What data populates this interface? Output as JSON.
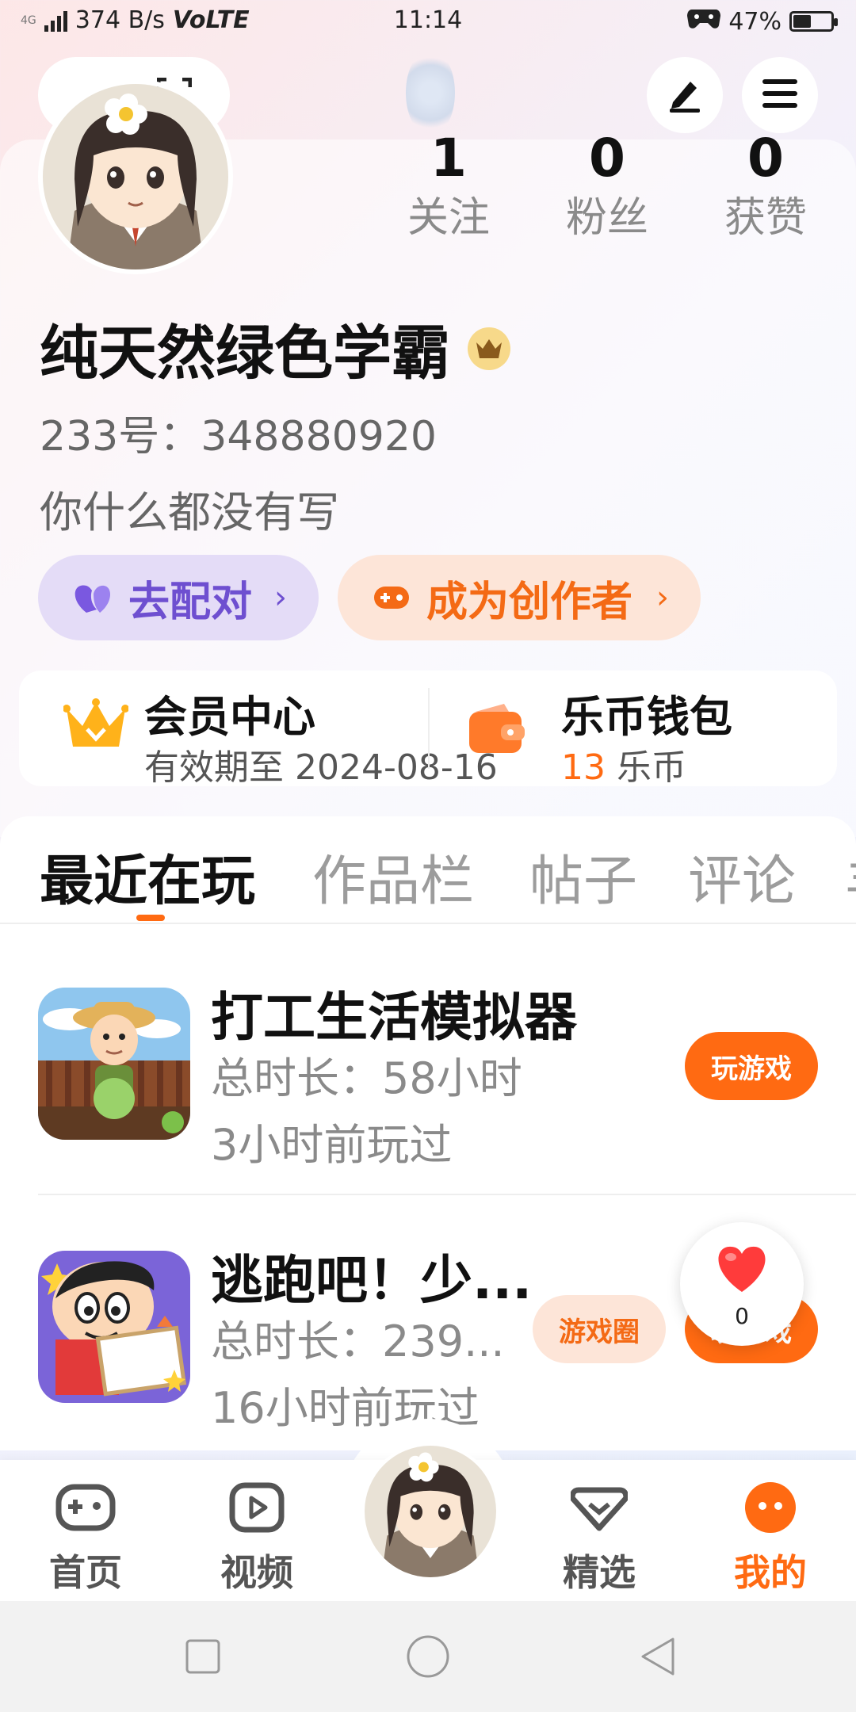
{
  "status_bar": {
    "network_type": "4G",
    "speed": "374 B/s",
    "volte": "VoLTE",
    "time": "11:14",
    "battery_percent": "47%",
    "battery_level": 0.47
  },
  "header": {
    "icons": [
      "scan-icon",
      "pencil-icon",
      "menu-icon"
    ]
  },
  "profile": {
    "stats": [
      {
        "value": "1",
        "label": "关注"
      },
      {
        "value": "0",
        "label": "粉丝"
      },
      {
        "value": "0",
        "label": "获赞"
      }
    ],
    "username": "纯天然绿色学霸",
    "uid": "233号：348880920",
    "bio": "你什么都没有写",
    "buttons": {
      "pair": "去配对",
      "creator": "成为创作者",
      "chevron": "›"
    }
  },
  "vip": {
    "member_title": "会员中心",
    "member_sub": "有效期至 2024-08-16",
    "wallet_title": "乐币钱包",
    "wallet_amount": "13",
    "wallet_unit": "乐币"
  },
  "tabs": [
    "最近在玩",
    "作品栏",
    "帖子",
    "评论",
    "羊"
  ],
  "games": [
    {
      "title": "打工生活模拟器",
      "total": "总时长：58小时",
      "last": "3小时前玩过",
      "play_label": "玩游戏"
    },
    {
      "title": "逃跑吧！少...",
      "total": "总时长：239...",
      "last": "16小时前玩过",
      "circle_label": "游戏圈",
      "play_label": "玩游戏"
    }
  ],
  "like_float": {
    "count": "0"
  },
  "bottom_nav": [
    {
      "label": "首页",
      "icon": "gamepad-icon"
    },
    {
      "label": "视频",
      "icon": "video-icon"
    },
    {
      "label": "精选",
      "icon": "heart-badge-icon"
    },
    {
      "label": "我的",
      "icon": "face-icon",
      "active": true
    }
  ],
  "colors": {
    "accent": "#ff6a12",
    "pair_text": "#6e4fd0",
    "pair_bg": "#e4dcf7",
    "creator_bg": "#fde5d8"
  }
}
